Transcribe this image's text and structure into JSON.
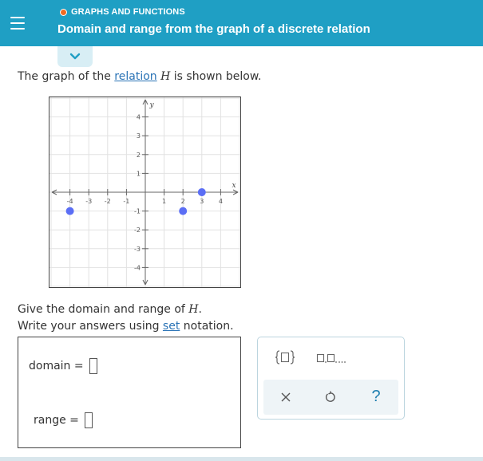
{
  "header": {
    "topic": "GRAPHS AND FUNCTIONS",
    "title": "Domain and range from the graph of a discrete relation"
  },
  "prompt": {
    "before": "The graph of the ",
    "link": "relation",
    "var": "H",
    "after": " is shown below."
  },
  "graph": {
    "x_axis_label": "x",
    "y_axis_label": "y",
    "x_ticks": [
      "-4",
      "-3",
      "-2",
      "-1",
      "1",
      "2",
      "3",
      "4"
    ],
    "y_ticks": [
      "4",
      "3",
      "2",
      "1",
      "-1",
      "-2",
      "-3",
      "-4"
    ],
    "point_color": "#5b6ef5"
  },
  "chart_data": {
    "type": "scatter",
    "xlabel": "x",
    "ylabel": "y",
    "xlim": [
      -5,
      5
    ],
    "ylim": [
      -5,
      5
    ],
    "grid": true,
    "points": [
      {
        "x": -4,
        "y": -1
      },
      {
        "x": 2,
        "y": -1
      },
      {
        "x": 3,
        "y": 0
      }
    ]
  },
  "question": {
    "line1_before": "Give the domain and range of ",
    "line1_var": "H",
    "line1_after": ".",
    "line2_before": "Write your answers using ",
    "line2_link": "set",
    "line2_after": " notation."
  },
  "answers": {
    "domain_label": "domain =",
    "range_label": "range ="
  },
  "keypad": {
    "set_template": "{□}",
    "list_template": "□,□,...",
    "clear": "×",
    "undo": "↺",
    "help": "?"
  }
}
